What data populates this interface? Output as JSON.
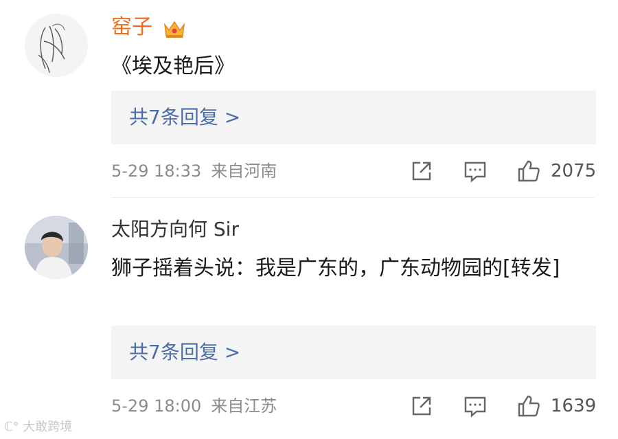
{
  "comments": [
    {
      "username": "窑子",
      "content": "《埃及艳后》",
      "replies_label": "共7条回复 >",
      "date": "5-29 18:33",
      "location": "来自河南",
      "likes": "2075"
    },
    {
      "username": "太阳方向何 Sir",
      "content": "狮子摇着头说：我是广东的，广东动物园的[转发]",
      "replies_label": "共7条回复 >",
      "date": "5-29 18:00",
      "location": "来自江苏",
      "likes": "1639"
    }
  ],
  "watermark": "大敢跨境",
  "icons": {
    "badge": "crown-icon",
    "share": "share-icon",
    "reply": "comment-icon",
    "like": "thumbs-up-icon"
  },
  "colors": {
    "vip_username": "#f26b1d",
    "link": "#4a6da8",
    "meta": "#8c8c8c"
  }
}
